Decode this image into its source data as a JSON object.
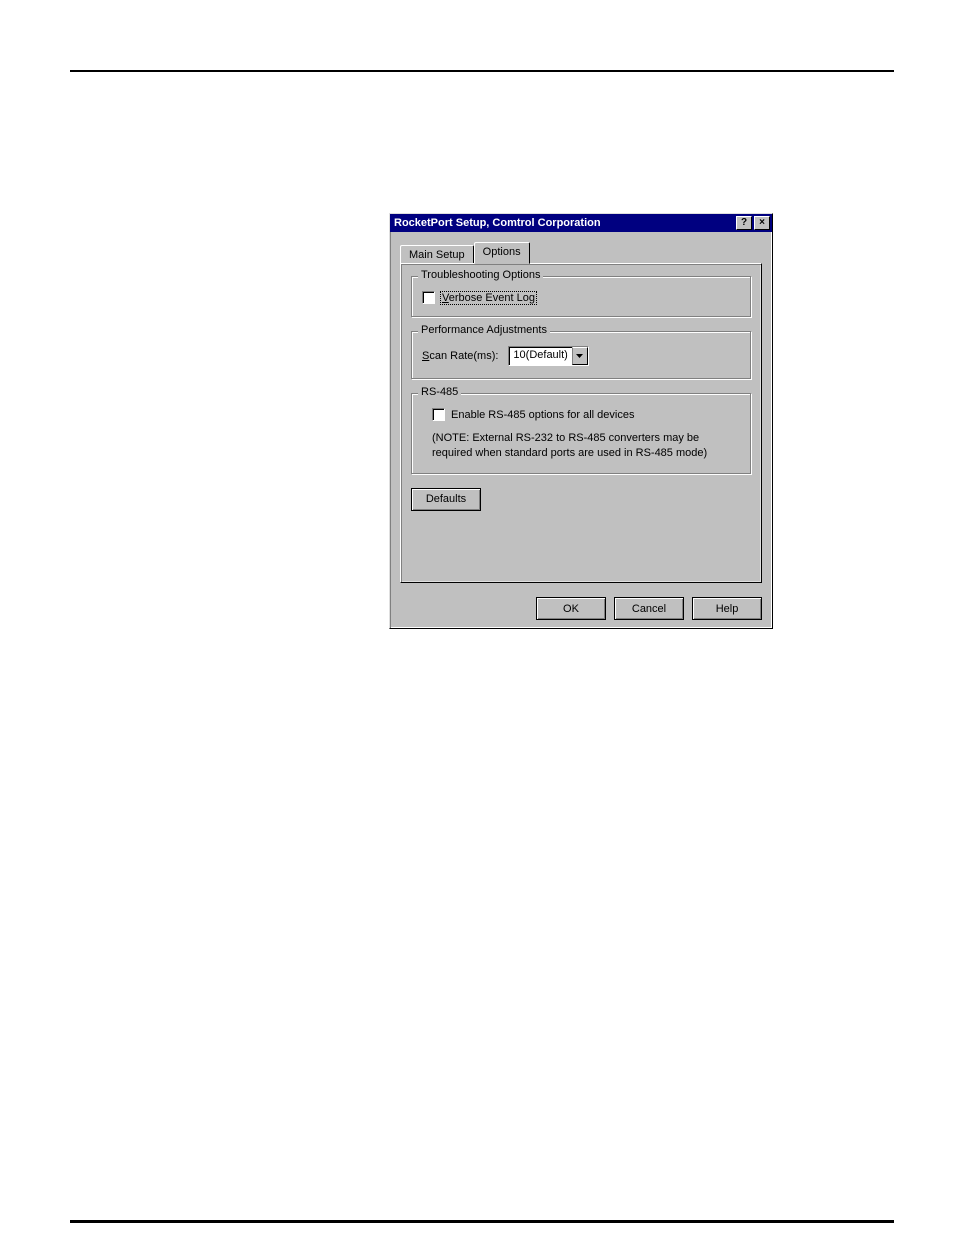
{
  "dialog": {
    "title": "RocketPort Setup, Comtrol Corporation",
    "tabs": {
      "main_setup": "Main Setup",
      "options": "Options"
    },
    "groups": {
      "troubleshooting": {
        "legend": "Troubleshooting Options",
        "verbose_label": "Verbose Event Log"
      },
      "performance": {
        "legend": "Performance Adjustments",
        "scan_rate_label": "Scan Rate(ms):",
        "scan_rate_value": "10(Default)"
      },
      "rs485": {
        "legend": "RS-485",
        "enable_label": "Enable RS-485 options for all devices",
        "note": "(NOTE: External RS-232 to RS-485 converters may be required when standard ports are used in RS-485 mode)"
      }
    },
    "buttons": {
      "defaults": "Defaults",
      "ok": "OK",
      "cancel": "Cancel",
      "help": "Help"
    },
    "titlebar_icons": {
      "help": "?",
      "close": "×"
    }
  }
}
